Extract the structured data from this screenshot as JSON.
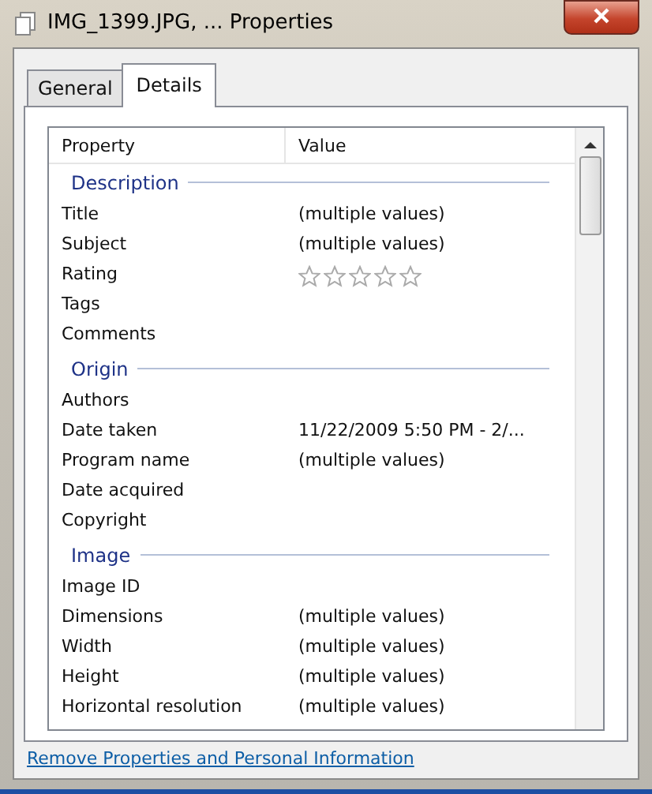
{
  "window": {
    "title": "IMG_1399.JPG, ... Properties"
  },
  "tabs": [
    {
      "label": "General",
      "selected": false
    },
    {
      "label": "Details",
      "selected": true
    }
  ],
  "table": {
    "columns": [
      "Property",
      "Value"
    ],
    "groups": [
      {
        "title": "Description",
        "rows": [
          {
            "property": "Title",
            "value": "(multiple values)"
          },
          {
            "property": "Subject",
            "value": "(multiple values)"
          },
          {
            "property": "Rating",
            "kind": "stars",
            "stars": 0
          },
          {
            "property": "Tags"
          },
          {
            "property": "Comments"
          }
        ]
      },
      {
        "title": "Origin",
        "rows": [
          {
            "property": "Authors"
          },
          {
            "property": "Date taken",
            "value": "11/22/2009 5:50 PM - 2/..."
          },
          {
            "property": "Program name",
            "value": "(multiple values)"
          },
          {
            "property": "Date acquired"
          },
          {
            "property": "Copyright"
          }
        ]
      },
      {
        "title": "Image",
        "rows": [
          {
            "property": "Image ID"
          },
          {
            "property": "Dimensions",
            "value": "(multiple values)"
          },
          {
            "property": "Width",
            "value": "(multiple values)"
          },
          {
            "property": "Height",
            "value": "(multiple values)"
          },
          {
            "property": "Horizontal resolution",
            "value": "(multiple values)"
          }
        ]
      }
    ]
  },
  "link": "Remove Properties and Personal Information"
}
